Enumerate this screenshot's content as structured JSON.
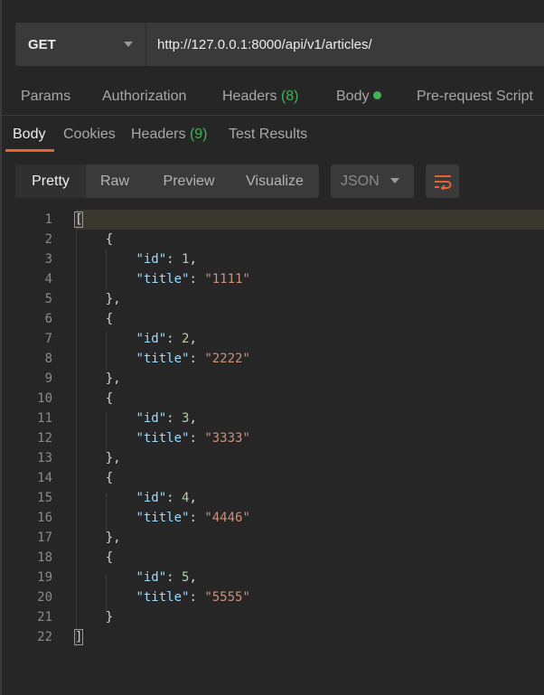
{
  "request": {
    "method": "GET",
    "url": "http://127.0.0.1:8000/api/v1/articles/"
  },
  "request_tabs": {
    "params": "Params",
    "authorization": "Authorization",
    "headers_label": "Headers",
    "headers_count": "(8)",
    "body": "Body",
    "prerequest": "Pre-request Script"
  },
  "response_tabs": {
    "body": "Body",
    "cookies": "Cookies",
    "headers_label": "Headers",
    "headers_count": "(9)",
    "test_results": "Test Results"
  },
  "toolbar": {
    "pretty": "Pretty",
    "raw": "Raw",
    "preview": "Preview",
    "visualize": "Visualize",
    "format": "JSON"
  },
  "colors": {
    "accent": "#e8622c",
    "green": "#3fb356",
    "json_key": "#9cdcfe",
    "json_number": "#b5cea8",
    "json_string": "#ce9178"
  },
  "icons": {
    "method_dropdown": "chevron-down-icon",
    "format_dropdown": "chevron-down-icon",
    "wrap": "wrap-lines-icon",
    "body_status": "green-dot-icon"
  },
  "response_body": {
    "line_numbers": [
      "1",
      "2",
      "3",
      "4",
      "5",
      "6",
      "7",
      "8",
      "9",
      "10",
      "11",
      "12",
      "13",
      "14",
      "15",
      "16",
      "17",
      "18",
      "19",
      "20",
      "21",
      "22"
    ],
    "articles": [
      {
        "id": "1",
        "title": "\"1111\""
      },
      {
        "id": "2",
        "title": "\"2222\""
      },
      {
        "id": "3",
        "title": "\"3333\""
      },
      {
        "id": "4",
        "title": "\"4446\""
      },
      {
        "id": "5",
        "title": "\"5555\""
      }
    ],
    "key_id": "\"id\"",
    "key_title": "\"title\""
  }
}
